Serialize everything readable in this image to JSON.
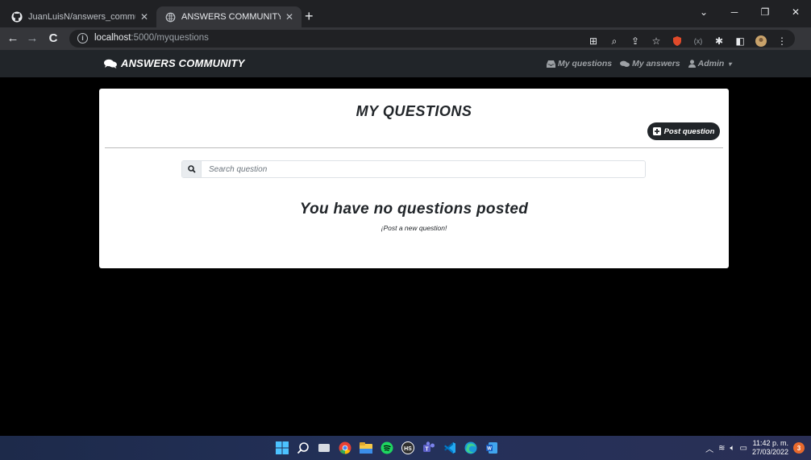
{
  "browser": {
    "tabs": [
      {
        "title": "JuanLuisN/answers_community",
        "icon": "github-icon",
        "active": false
      },
      {
        "title": "ANSWERS COMMUNITY",
        "icon": "globe-icon",
        "active": true
      }
    ],
    "new_tab": "+",
    "url_host": "localhost",
    "url_path": ":5000/myquestions"
  },
  "navbar": {
    "brand": "ANSWERS COMMUNITY",
    "links": [
      {
        "label": "My questions",
        "icon": "inbox-icon"
      },
      {
        "label": "My answers",
        "icon": "comments-icon"
      },
      {
        "label": "Admin",
        "icon": "user-icon"
      }
    ]
  },
  "main": {
    "title": "MY QUESTIONS",
    "post_button": "Post question",
    "search_placeholder": "Search question",
    "empty_title": "You have no questions posted",
    "empty_subtitle": "¡Post a new question!"
  },
  "taskbar": {
    "time": "11:42 p. m.",
    "date": "27/03/2022",
    "notifications": "3"
  },
  "colors": {
    "navbar_bg": "#212529",
    "page_bg": "#000000",
    "card_bg": "#ffffff",
    "button_bg": "#212529"
  }
}
